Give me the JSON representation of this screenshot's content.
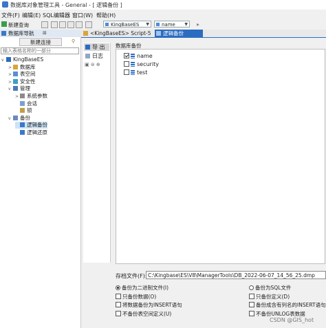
{
  "window": {
    "title": "数据库对象管理工具 - General - [ 逻辑备份 ]"
  },
  "menu": [
    "文件(F)",
    "编辑(E)",
    "SQL编辑器",
    "窗口(W)",
    "帮助(H)"
  ],
  "toolbar": {
    "new_query": "新建查询",
    "server_combo": "KingBaseES",
    "db_combo": "name"
  },
  "left": {
    "tab_label": "数据库导航",
    "new_connection": "新建连接",
    "filter_placeholder": "输入表格名称的一部分",
    "tree": [
      {
        "label": "KingBaseES",
        "level": 0,
        "twisty": "v"
      },
      {
        "label": "数据库",
        "level": 1,
        "twisty": ">"
      },
      {
        "label": "表空间",
        "level": 1,
        "twisty": ">"
      },
      {
        "label": "安全性",
        "level": 1,
        "twisty": ">"
      },
      {
        "label": "管理",
        "level": 1,
        "twisty": "v"
      },
      {
        "label": "系统参数",
        "level": 2,
        "twisty": ">"
      },
      {
        "label": "会话",
        "level": 2,
        "twisty": ""
      },
      {
        "label": "锁",
        "level": 2,
        "twisty": ""
      },
      {
        "label": "备份",
        "level": 1,
        "twisty": "v"
      },
      {
        "label": "逻辑备份",
        "level": 2,
        "twisty": ""
      },
      {
        "label": "逻辑还原",
        "level": 2,
        "twisty": ""
      }
    ]
  },
  "editor": {
    "tab1": "<KingBaseES> Script-5",
    "tab2": "逻辑备份",
    "side_export": "导 出",
    "side_log": "日志",
    "db_list_label": "数据库备份",
    "databases": [
      {
        "name": "name",
        "checked": true
      },
      {
        "name": "security",
        "checked": false
      },
      {
        "name": "test",
        "checked": false
      }
    ],
    "archive_label": "存档文件(F):",
    "archive_path": "C:\\Kingbase\\ES\\V8\\ManagerTools\\DB_2022-06-07_14_56_25.dmp",
    "options": {
      "binary": "备份为二进制文件(I)",
      "sql": "备份为SQL文件",
      "data_only": "只备份数据(O)",
      "schema_only": "只备份定义(D)",
      "insert": "将数据备份为INSERT语句",
      "insert_cols": "备份成含有列名的INSERT语句",
      "no_tablespace": "不备份表空间定义(U)",
      "no_unlog": "不备份UNLOG表数据"
    }
  },
  "watermark": "CSDN @GIS_hot"
}
